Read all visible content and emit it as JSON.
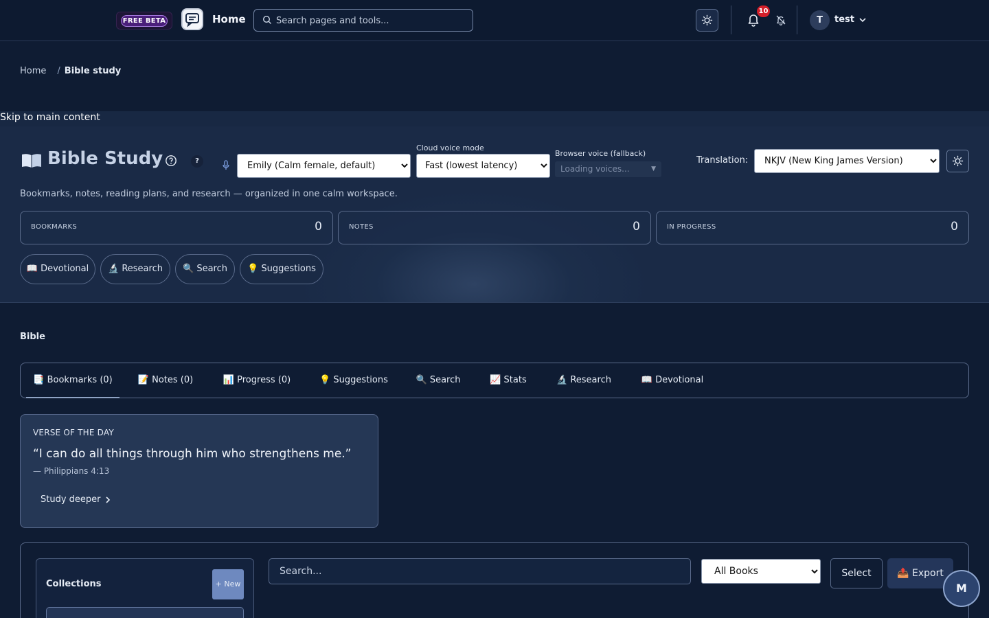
{
  "topbar": {
    "beta_label": "FREE BETA",
    "home_title": "Home",
    "search_placeholder": "Search pages and tools...",
    "notification_count": "10",
    "avatar_initial": "T",
    "username": "test"
  },
  "breadcrumb": {
    "home": "Home",
    "separator": "/",
    "current": "Bible study"
  },
  "skip_link": "Skip to main content",
  "hero": {
    "title": "Bible Study",
    "help_tooltip": "?",
    "voice_select": {
      "value": "Emily (Calm female, default)"
    },
    "cloud_mode": {
      "label": "Cloud voice mode",
      "value": "Fast (lowest latency)"
    },
    "browser_voice": {
      "label": "Browser voice (fallback)",
      "value": "Loading voices...",
      "arrow": "▼"
    },
    "translation": {
      "label": "Translation:",
      "value": "NKJV (New King James Version)"
    },
    "subtitle": "Bookmarks, notes, reading plans, and research — organized in one calm workspace.",
    "stats": [
      {
        "label": "BOOKMARKS",
        "value": "0"
      },
      {
        "label": "NOTES",
        "value": "0"
      },
      {
        "label": "IN PROGRESS",
        "value": "0"
      }
    ],
    "quick_actions": [
      "📖 Devotional",
      "🔬 Research",
      "🔍 Search",
      "💡 Suggestions"
    ]
  },
  "section_title": "Bible",
  "tabs": [
    "📑 Bookmarks (0)",
    "📝 Notes (0)",
    "📊 Progress (0)",
    "💡 Suggestions",
    "🔍 Search",
    "📈 Stats",
    "🔬 Research",
    "📖 Devotional"
  ],
  "verse_of_day": {
    "label": "VERSE OF THE DAY",
    "quote": "“I can do all things through him who strengthens me.”",
    "reference": "— Philippians 4:13",
    "action": "Study deeper"
  },
  "collections": {
    "title": "Collections",
    "new_label": "+ New"
  },
  "filters": {
    "search_placeholder": "Search...",
    "books_value": "All Books",
    "select_label": "Select",
    "export_label": "📤 Export"
  },
  "fab_label": "M",
  "colors": {
    "background": "#0f1c33",
    "hero": "#1c2e4b",
    "badge": "#d31f2a",
    "beta": "#4a1f7a"
  }
}
